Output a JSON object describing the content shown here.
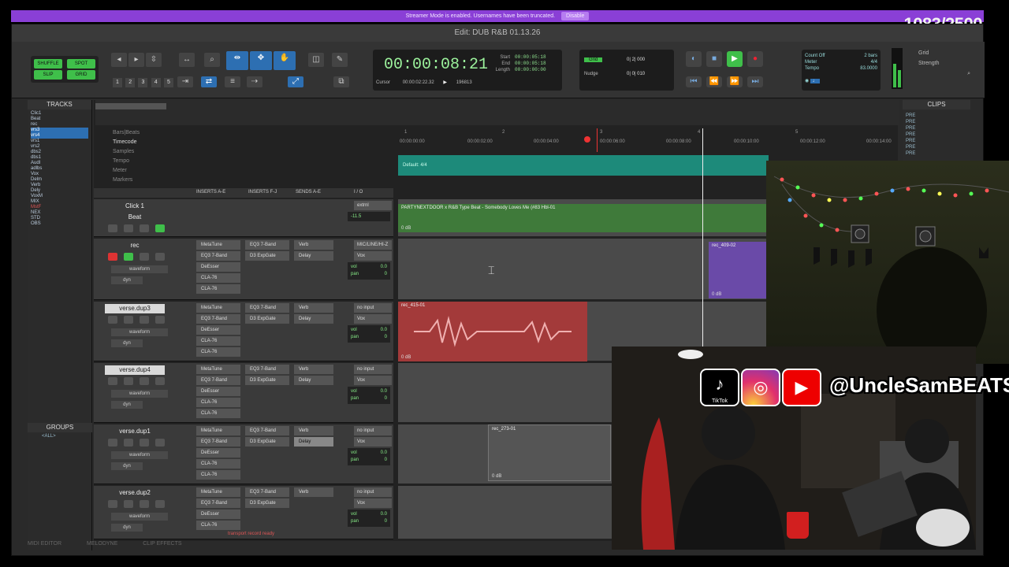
{
  "banner": {
    "message": "Streamer Mode is enabled. Usernames have been truncated.",
    "disable_label": "Disable"
  },
  "stream_counter": "1083/2500",
  "window": {
    "title": "Edit: DUB R&B 01.13.26"
  },
  "toolbar": {
    "modes": [
      "SHUFFLE",
      "SPOT",
      "SLIP",
      "GRID"
    ],
    "zoom_presets": [
      "1",
      "2",
      "3",
      "4",
      "5"
    ],
    "main_counter": "00:00:08:21",
    "selection_labels": [
      "Start",
      "End",
      "Length"
    ],
    "selection_values": [
      "00:00:05:18",
      "00:00:05:18",
      "00:00:00:00"
    ],
    "cursor_label": "Cursor",
    "cursor_value": "00:00:02:22.32",
    "sample_value": "196813",
    "grid_label": "Grid",
    "grid_value": "0| 2| 000",
    "nudge_label": "Nudge",
    "nudge_value": "0| 0| 010",
    "count_off": "Count Off",
    "count_bars": "2 bars",
    "meter_label": "Meter",
    "meter_value": "4/4",
    "tempo_label": "Tempo",
    "tempo_value": "83.0000",
    "grid_side": "Grid",
    "strength": "Strength"
  },
  "left_panel": {
    "tracks_title": "TRACKS",
    "tracks": [
      "Clic1",
      "Beat",
      "rec",
      "vrs3",
      "vrs4",
      "vrs1",
      "vrs2",
      "dbs2",
      "dbs1",
      "AudI",
      "adlbs",
      "Vox",
      "Delm",
      "Verb",
      "Dely",
      "VoxM",
      "MIX",
      "MstF",
      "NEX",
      "STD",
      "OBS"
    ],
    "groups_title": "GROUPS",
    "groups_all": "<ALL>"
  },
  "rulers": {
    "labels": [
      "Bars|Beats",
      "Timecode",
      "Samples",
      "Tempo",
      "Meter",
      "Markers"
    ],
    "timecodes": [
      "00:00:00:00",
      "00:00:02:00",
      "00:00:04:00",
      "00:00:06:00",
      "00:00:08:00",
      "00:00:10:00",
      "00:00:12:00",
      "00:00:14:00"
    ],
    "bars": [
      "1",
      "2",
      "3",
      "4",
      "5"
    ],
    "tempo_marker": "Default: 4/4"
  },
  "col_heads": [
    "INSERTS A-E",
    "INSERTS F-J",
    "SENDS A-E",
    "I / O"
  ],
  "tracks": [
    {
      "name": "Click 1",
      "sub": "Beat",
      "io": "extrnl",
      "inserts": [],
      "vol": "-11.5",
      "pan": ""
    },
    {
      "name": "rec",
      "inserts": [
        "MetaTune",
        "EQ3 7-Band",
        "DeEsser",
        "CLA-76",
        "CLA-76"
      ],
      "inserts2": [
        "EQ3 7-Band",
        "D3 ExpGate"
      ],
      "sends": [
        "Verb",
        "Delay"
      ],
      "io": "MIC/LINE/HI-Z",
      "io2": "Vox",
      "vol": "0.0",
      "pan": "0"
    },
    {
      "name": "verse.dup3",
      "inserts": [
        "MetaTune",
        "EQ3 7-Band",
        "DeEsser",
        "CLA-76",
        "CLA-76"
      ],
      "inserts2": [
        "EQ3 7-Band",
        "D3 ExpGate"
      ],
      "sends": [
        "Verb",
        "Delay"
      ],
      "io": "no input",
      "io2": "Vox",
      "vol": "0.0",
      "pan": "0"
    },
    {
      "name": "verse.dup4",
      "inserts": [
        "MetaTune",
        "EQ3 7-Band",
        "DeEsser",
        "CLA-76",
        "CLA-76"
      ],
      "inserts2": [
        "EQ3 7-Band",
        "D3 ExpGate"
      ],
      "sends": [
        "Verb",
        "Delay"
      ],
      "io": "no input",
      "io2": "Vox",
      "vol": "0.0",
      "pan": "0"
    },
    {
      "name": "verse.dup1",
      "inserts": [
        "MetaTune",
        "EQ3 7-Band",
        "DeEsser",
        "CLA-76",
        "CLA-76"
      ],
      "inserts2": [
        "EQ3 7-Band",
        "D3 ExpGate"
      ],
      "sends": [
        "Verb",
        "Delay"
      ],
      "io": "no input",
      "io2": "Vox",
      "vol": "0.0",
      "pan": "0"
    },
    {
      "name": "verse.dup2",
      "inserts": [
        "MetaTune",
        "EQ3 7-Band",
        "DeEsser",
        "CLA-76"
      ],
      "inserts2": [
        "EQ3 7-Band",
        "D3 ExpGate"
      ],
      "sends": [
        "Verb"
      ],
      "io": "no input",
      "io2": "Vox",
      "vol": "0.0",
      "pan": "0"
    }
  ],
  "waveform_label": "waveform",
  "dyn_label": "dyn",
  "clips": {
    "beat": "PARTYNEXTDOOR x R&B Type Beat - Somebody Loves Me (#83 Hbl-01",
    "beat_db": "0 dB",
    "rec": "rec_409-02",
    "rec_db": "0 dB",
    "verse": "rec_415-01",
    "verse_db": "0 dB",
    "dup1": "rec_273-01",
    "dup1_db": "0 dB"
  },
  "clips_panel": {
    "title": "CLIPS",
    "items": [
      "PRE",
      "PRE",
      "PRE",
      "PRE",
      "PRE",
      "PRE",
      "PRE"
    ]
  },
  "bottom_tabs": [
    "MIDI EDITOR",
    "MELODYNE",
    "CLIP EFFECTS"
  ],
  "status": "transport record ready",
  "social": {
    "tiktok_label": "TikTok",
    "handle": "@UncleSamBEATS"
  }
}
